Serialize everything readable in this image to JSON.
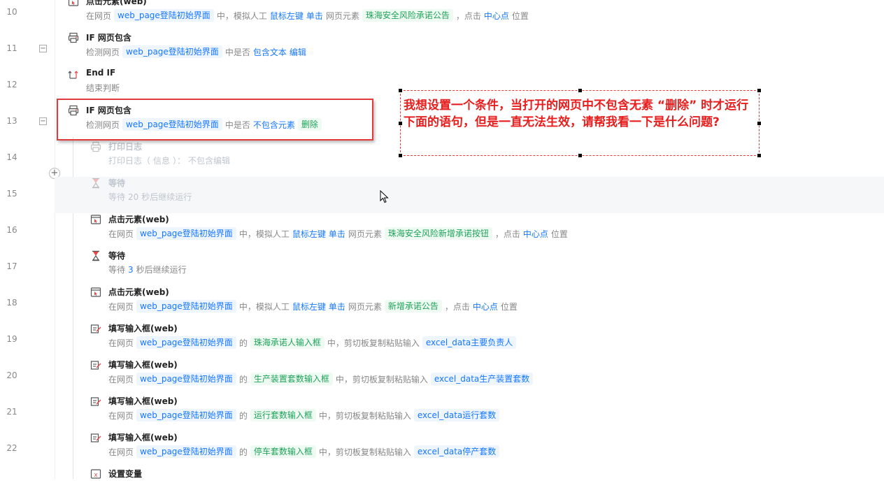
{
  "line_numbers": [
    "10",
    "11",
    "12",
    "13",
    "14",
    "15",
    "16",
    "17",
    "18",
    "19",
    "20",
    "21",
    "22"
  ],
  "steps": [
    {
      "icon": "click-element-icon",
      "title": "点击元素(web)",
      "desc": [
        {
          "t": "在网页"
        },
        {
          "t": "web_page登陆初始界面",
          "c": "blue"
        },
        {
          "t": "中，模拟人工"
        },
        {
          "t": "鼠标左键",
          "k": 1
        },
        {
          "t": "单击",
          "k": 1
        },
        {
          "t": "网页元素"
        },
        {
          "t": "珠海安全风险承诺公告",
          "c": "green"
        },
        {
          "t": "，点击"
        },
        {
          "t": "中心点",
          "k": 1
        },
        {
          "t": "位置"
        }
      ]
    },
    {
      "icon": "if-web-contains-icon",
      "title": "IF 网页包含",
      "desc": [
        {
          "t": "检测网页"
        },
        {
          "t": "web_page登陆初始界面",
          "c": "blue"
        },
        {
          "t": "中是否"
        },
        {
          "t": "包含文本",
          "k": 1
        },
        {
          "t": "编辑",
          "k": 1
        }
      ]
    },
    {
      "icon": "end-if-icon",
      "title": "End IF",
      "desc": [
        {
          "t": "结束判断"
        }
      ]
    },
    {
      "icon": "if-web-contains-icon",
      "title": "IF 网页包含",
      "desc": [
        {
          "t": "检测网页"
        },
        {
          "t": "web_page登陆初始界面",
          "c": "blue"
        },
        {
          "t": "中是否"
        },
        {
          "t": "不包含元素",
          "k": 1
        },
        {
          "t": "删除",
          "c": "green"
        }
      ]
    },
    {
      "icon": "print-log-icon",
      "title": "打印日志",
      "disabled": true,
      "desc": [
        {
          "t": "打印日志（"
        },
        {
          "t": "信息",
          "k": 1
        },
        {
          "t": "）："
        },
        {
          "t": "不包含编辑",
          "k": 1
        }
      ]
    },
    {
      "icon": "wait-icon",
      "title": "等待",
      "disabled": true,
      "highlight": true,
      "desc": [
        {
          "t": "等待"
        },
        {
          "t": "20",
          "k": 1
        },
        {
          "t": "秒后继续运行"
        }
      ]
    },
    {
      "icon": "click-element-icon",
      "title": "点击元素(web)",
      "desc": [
        {
          "t": "在网页"
        },
        {
          "t": "web_page登陆初始界面",
          "c": "blue"
        },
        {
          "t": "中，模拟人工"
        },
        {
          "t": "鼠标左键",
          "k": 1
        },
        {
          "t": "单击",
          "k": 1
        },
        {
          "t": "网页元素"
        },
        {
          "t": "珠海安全风险新增承诺按钮",
          "c": "green"
        },
        {
          "t": "，点击"
        },
        {
          "t": "中心点",
          "k": 1
        },
        {
          "t": "位置"
        }
      ]
    },
    {
      "icon": "wait-icon",
      "title": "等待",
      "desc": [
        {
          "t": "等待"
        },
        {
          "t": "3",
          "k": 1
        },
        {
          "t": "秒后继续运行"
        }
      ]
    },
    {
      "icon": "click-element-icon",
      "title": "点击元素(web)",
      "desc": [
        {
          "t": "在网页"
        },
        {
          "t": "web_page登陆初始界面",
          "c": "blue"
        },
        {
          "t": "中，模拟人工"
        },
        {
          "t": "鼠标左键",
          "k": 1
        },
        {
          "t": "单击",
          "k": 1
        },
        {
          "t": "网页元素"
        },
        {
          "t": "新增承诺公告",
          "c": "green"
        },
        {
          "t": "，点击"
        },
        {
          "t": "中心点",
          "k": 1
        },
        {
          "t": "位置"
        }
      ]
    },
    {
      "icon": "fill-input-icon",
      "title": "填写输入框(web)",
      "desc": [
        {
          "t": "在网页"
        },
        {
          "t": "web_page登陆初始界面",
          "c": "blue"
        },
        {
          "t": "的"
        },
        {
          "t": "珠海承诺人输入框",
          "c": "green"
        },
        {
          "t": "中，剪切板复制粘贴输入"
        },
        {
          "t": "excel_data主要负责人",
          "c": "blue"
        }
      ]
    },
    {
      "icon": "fill-input-icon",
      "title": "填写输入框(web)",
      "desc": [
        {
          "t": "在网页"
        },
        {
          "t": "web_page登陆初始界面",
          "c": "blue"
        },
        {
          "t": "的"
        },
        {
          "t": "生产装置套数输入框",
          "c": "green"
        },
        {
          "t": "中，剪切板复制粘贴输入"
        },
        {
          "t": "excel_data生产装置套数",
          "c": "blue"
        }
      ]
    },
    {
      "icon": "fill-input-icon",
      "title": "填写输入框(web)",
      "desc": [
        {
          "t": "在网页"
        },
        {
          "t": "web_page登陆初始界面",
          "c": "blue"
        },
        {
          "t": "的"
        },
        {
          "t": "运行套数输入框",
          "c": "green"
        },
        {
          "t": "中，剪切板复制粘贴输入"
        },
        {
          "t": "excel_data运行套数",
          "c": "blue"
        }
      ]
    },
    {
      "icon": "fill-input-icon",
      "title": "填写输入框(web)",
      "desc": [
        {
          "t": "在网页"
        },
        {
          "t": "web_page登陆初始界面",
          "c": "blue"
        },
        {
          "t": "的"
        },
        {
          "t": "停车套数输入框",
          "c": "green"
        },
        {
          "t": "中，剪切板复制粘贴输入"
        },
        {
          "t": "excel_data停产套数",
          "c": "blue"
        }
      ]
    },
    {
      "icon": "set-variable-icon",
      "title": "设置变量",
      "desc": []
    }
  ],
  "annotation": {
    "text": "我想设置一个条件，当打开的网页中不包含无素 “删除” 时才运行下面的语句，但是一直无法生效，请帮我看一下是什么问题?",
    "color": "#e61e1e"
  },
  "fold_markers": [
    "−",
    "−"
  ],
  "add_symbol": "+"
}
